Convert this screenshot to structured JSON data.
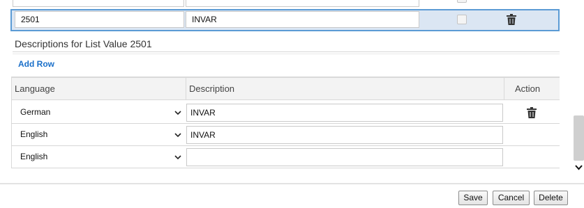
{
  "list_value_row": {
    "code": "2501",
    "description": "INVAR"
  },
  "descriptions_section": {
    "title": "Descriptions for List Value 2501",
    "add_row_label": "Add Row",
    "columns": {
      "language": "Language",
      "description": "Description",
      "action": "Action"
    },
    "rows": [
      {
        "language": "German",
        "description": "INVAR",
        "has_delete": true
      },
      {
        "language": "English",
        "description": "INVAR",
        "has_delete": false
      },
      {
        "language": "English",
        "description": "",
        "has_delete": false
      }
    ]
  },
  "footer": {
    "save_label": "Save",
    "cancel_label": "Cancel",
    "delete_label": "Delete"
  },
  "icons": {
    "delete": "trash-icon",
    "dropdown": "chevron-down-icon",
    "scroll": "chevron-down-icon"
  }
}
